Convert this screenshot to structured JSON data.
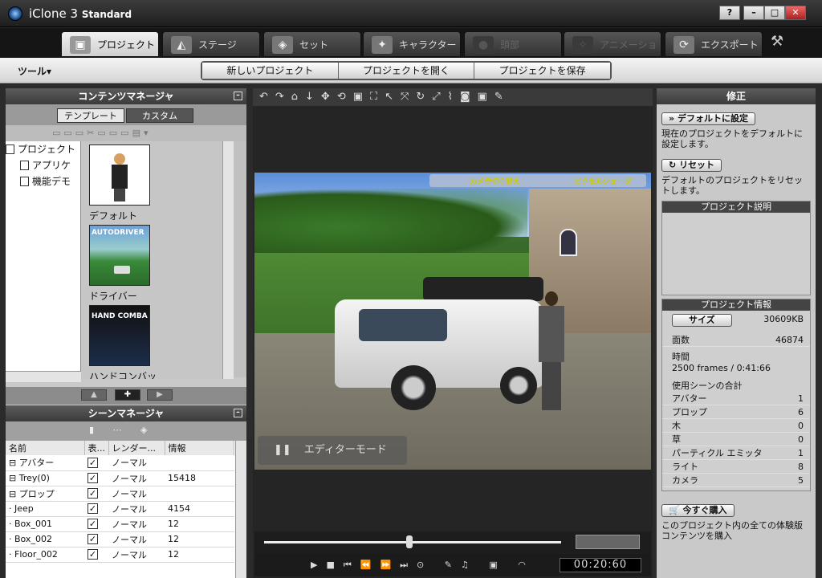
{
  "app": {
    "title": "iClone",
    "version": "3",
    "edition": "Standard"
  },
  "window_controls": [
    "?",
    "–",
    "□",
    "✕"
  ],
  "tabs": [
    {
      "label": "プロジェクト",
      "icon": "project-icon",
      "active": true
    },
    {
      "label": "ステージ",
      "icon": "stage-icon",
      "active": false
    },
    {
      "label": "セット",
      "icon": "set-icon",
      "active": false
    },
    {
      "label": "キャラクター",
      "icon": "character-icon",
      "active": false
    },
    {
      "label": "頭部",
      "icon": "head-icon",
      "active": false,
      "disabled": true
    },
    {
      "label": "アニメーション",
      "icon": "animation-icon",
      "active": false,
      "disabled": true
    },
    {
      "label": "エクスポート",
      "icon": "export-icon",
      "active": false
    }
  ],
  "toolbar": {
    "tool_menu": "ツール▾",
    "new_project": "新しいプロジェクト",
    "open_project": "プロジェクトを開く",
    "save_project": "プロジェクトを保存"
  },
  "content_manager": {
    "title": "コンテンツマネージャ",
    "subtab_template": "テンプレート",
    "subtab_custom": "カスタム",
    "tree": [
      "プロジェクト",
      "アプリケ",
      "機能デモ"
    ],
    "thumbs": [
      {
        "label": "デフォルト"
      },
      {
        "label": "ドライバー",
        "overlay": "AUTODRIVER"
      },
      {
        "label": "ハンドコンバッ",
        "overlay": "HAND COMBA"
      }
    ]
  },
  "scene_manager": {
    "title": "シーンマネージャ",
    "columns": [
      "名前",
      "表...",
      "レンダー...",
      "情報"
    ],
    "rows": [
      {
        "name": "⊟ アバター",
        "checked": true,
        "render": "ノーマル",
        "info": ""
      },
      {
        "name": "   ⊟ Trey(0)",
        "checked": true,
        "render": "ノーマル",
        "info": "15418"
      },
      {
        "name": "⊟ プロップ",
        "checked": true,
        "render": "ノーマル",
        "info": ""
      },
      {
        "name": "   · Jeep",
        "checked": true,
        "render": "ノーマル",
        "info": "4154"
      },
      {
        "name": "   · Box_001",
        "checked": true,
        "render": "ノーマル",
        "info": "12"
      },
      {
        "name": "   · Box_002",
        "checked": true,
        "render": "ノーマル",
        "info": "12"
      },
      {
        "name": "   · Floor_002",
        "checked": true,
        "render": "ノーマル",
        "info": "12"
      }
    ]
  },
  "viewport": {
    "camera_switch": "カメラ切り替え",
    "pixel_shader": "ピクセルシェーダ",
    "editor_mode": "エディターモード"
  },
  "playback": {
    "timecode": "00:20:60",
    "progress": 0.49
  },
  "modify": {
    "title": "修正",
    "set_default_button": "デフォルトに設定",
    "set_default_desc": "現在のプロジェクトをデフォルトに設定します。",
    "reset_button": "リセット",
    "reset_desc": "デフォルトのプロジェクトをリセットします。",
    "description_header": "プロジェクト説明",
    "info_header": "プロジェクト情報",
    "size_button": "サイズ",
    "size_value": "30609KB",
    "faces_label": "面数",
    "faces_value": "46874",
    "time_label": "時間",
    "time_frames": "2500 frames",
    "time_sep": "/",
    "time_duration": "0:41:66",
    "totals_label": "使用シーンの合計",
    "totals": [
      {
        "label": "アバター",
        "value": "1"
      },
      {
        "label": "プロップ",
        "value": "6"
      },
      {
        "label": "木",
        "value": "0"
      },
      {
        "label": "草",
        "value": "0"
      },
      {
        "label": "パーティクル エミッタ",
        "value": "1"
      },
      {
        "label": "ライト",
        "value": "8"
      },
      {
        "label": "カメラ",
        "value": "5"
      }
    ],
    "buy_button": "今すぐ購入",
    "buy_desc": "このプロジェクト内の全ての体験版コンテンツを購入"
  }
}
